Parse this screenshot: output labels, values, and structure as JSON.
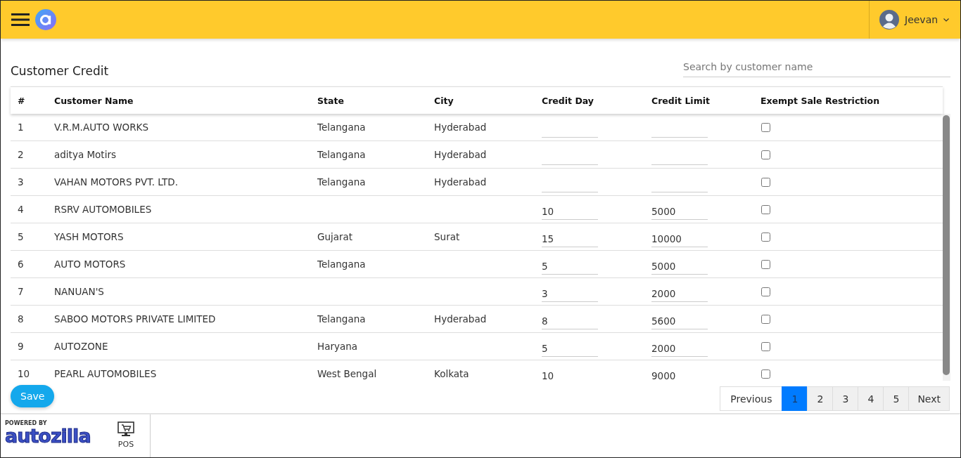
{
  "header": {
    "user_name": "Jeevan"
  },
  "page": {
    "title": "Customer Credit",
    "search": {
      "placeholder": "Search by customer name"
    }
  },
  "table": {
    "columns": [
      "#",
      "Customer Name",
      "State",
      "City",
      "Credit Day",
      "Credit Limit",
      "Exempt Sale Restriction"
    ],
    "rows": [
      {
        "no": "1",
        "name": "V.R.M.AUTO WORKS",
        "state": "Telangana",
        "city": "Hyderabad",
        "exempt": false
      },
      {
        "no": "2",
        "name": "aditya Motirs",
        "state": "Telangana",
        "city": "Hyderabad",
        "exempt": false
      },
      {
        "no": "3",
        "name": "VAHAN MOTORS PVT. LTD.",
        "state": "Telangana",
        "city": "Hyderabad",
        "exempt": false
      },
      {
        "no": "4",
        "name": "RSRV AUTOMOBILES",
        "credit_day": "10",
        "credit_limit": "5000",
        "exempt": false
      },
      {
        "no": "5",
        "name": "YASH MOTORS",
        "state": "Gujarat",
        "city": "Surat",
        "credit_day": "15",
        "credit_limit": "10000",
        "exempt": false
      },
      {
        "no": "6",
        "name": "AUTO MOTORS",
        "state": "Telangana",
        "credit_day": "5",
        "credit_limit": "5000",
        "exempt": false
      },
      {
        "no": "7",
        "name": "NANUAN'S",
        "credit_day": "3",
        "credit_limit": "2000",
        "exempt": false
      },
      {
        "no": "8",
        "name": "SABOO MOTORS PRIVATE LIMITED",
        "state": "Telangana",
        "city": "Hyderabad",
        "credit_day": "8",
        "credit_limit": "5600",
        "exempt": false
      },
      {
        "no": "9",
        "name": "AUTOZONE",
        "state": "Haryana",
        "credit_day": "5",
        "credit_limit": "2000",
        "exempt": false
      },
      {
        "no": "10",
        "name": "PEARL AUTOMOBILES",
        "state": "West Bengal",
        "city": "Kolkata",
        "credit_day": "10",
        "credit_limit": "9000",
        "exempt": false
      }
    ]
  },
  "save_button": "Save",
  "pagination": [
    {
      "label": "Previous",
      "selected": false
    },
    {
      "label": "1",
      "selected": true
    },
    {
      "label": "2",
      "selected": false
    },
    {
      "label": "3",
      "selected": false
    },
    {
      "label": "4",
      "selected": false
    },
    {
      "label": "5",
      "selected": false
    },
    {
      "label": "Next",
      "selected": false
    }
  ],
  "footer": {
    "powered_by": "POWERED BY",
    "brand": "autozilla",
    "pos_label": "POS"
  }
}
